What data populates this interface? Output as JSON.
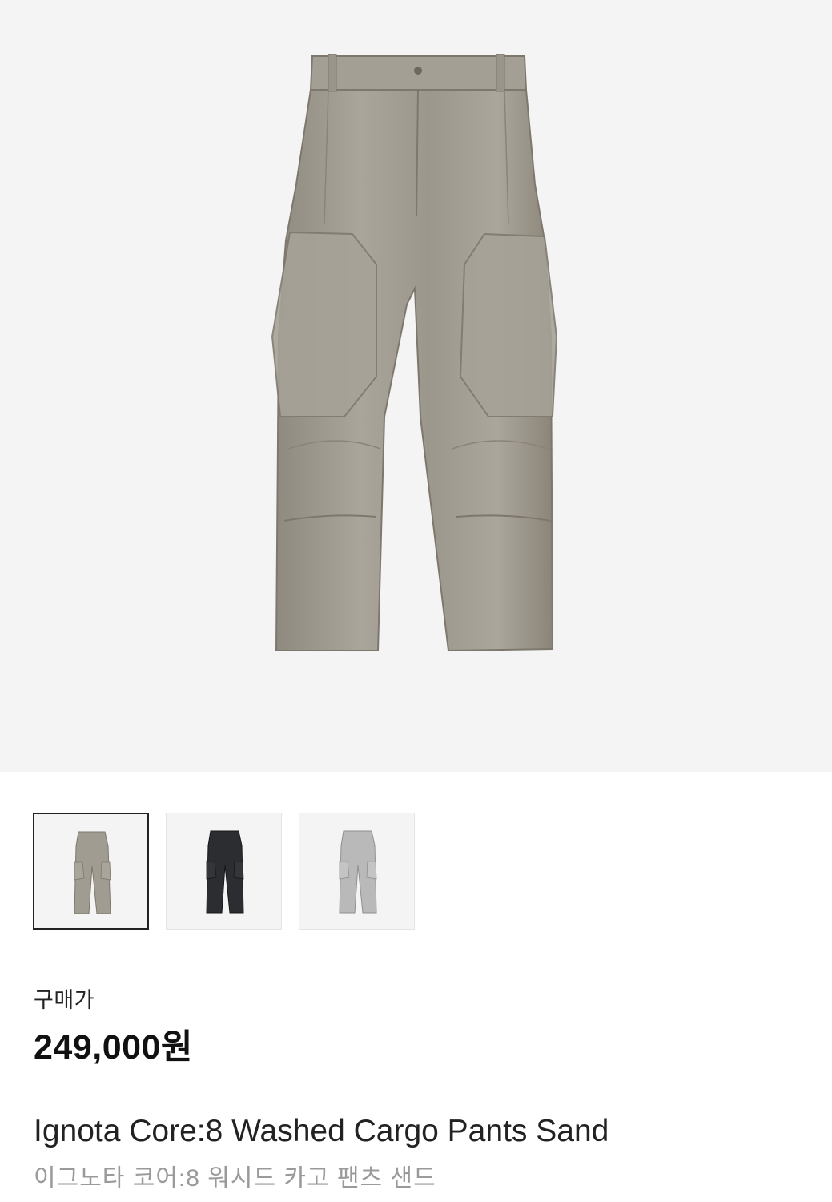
{
  "gallery": {
    "main_image_alt": "product-image-sand",
    "thumbnails": [
      {
        "id": "sand",
        "color": "#a09c92",
        "selected": true
      },
      {
        "id": "black",
        "color": "#2b2d30",
        "selected": false
      },
      {
        "id": "grey",
        "color": "#b9b9ba",
        "selected": false
      }
    ]
  },
  "pricing": {
    "label": "구매가",
    "price": "249,000원"
  },
  "product": {
    "name_en": "Ignota Core:8 Washed Cargo Pants Sand",
    "name_ko": "이그노타 코어:8 워시드 카고 팬츠 샌드"
  },
  "colors": {
    "hero_bg": "#f4f4f4",
    "pants_sand": "#a09c92",
    "pants_sand_shadow": "#857f74",
    "pants_black": "#2b2d30",
    "pants_grey": "#b9b9ba"
  }
}
